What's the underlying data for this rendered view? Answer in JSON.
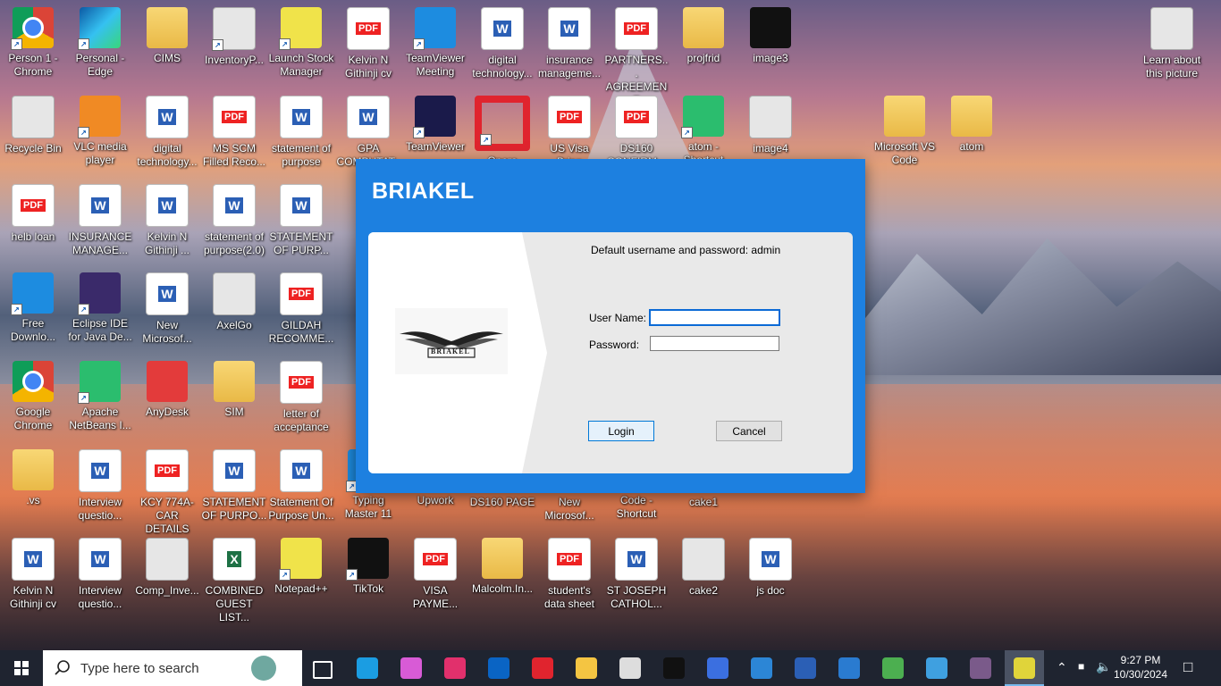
{
  "desktop": {
    "icons": [
      {
        "label": "Person 1 -\nChrome",
        "type": "chrome",
        "shortcut": true
      },
      {
        "label": "Personal -\nEdge",
        "type": "edge",
        "shortcut": true
      },
      {
        "label": "CIMS",
        "type": "folder"
      },
      {
        "label": "InventoryP...",
        "type": "gray",
        "shortcut": true
      },
      {
        "label": "Launch Stock\nManager",
        "type": "yellow",
        "shortcut": true
      },
      {
        "label": "Kelvin N\nGithinji cv",
        "type": "pdf"
      },
      {
        "label": "TeamViewer\nMeeting",
        "type": "blue",
        "shortcut": true
      },
      {
        "label": "digital\ntechnology...",
        "type": "word"
      },
      {
        "label": "insurance\nmanageme...",
        "type": "word"
      },
      {
        "label": "PARTNERS...\nAGREEMENT",
        "type": "pdf"
      },
      {
        "label": "projfrid",
        "type": "folder"
      },
      {
        "label": "image3",
        "type": "black"
      },
      {
        "label": "Recycle Bin",
        "type": "gray"
      },
      {
        "label": "VLC media\nplayer",
        "type": "orange",
        "shortcut": true
      },
      {
        "label": "digital\ntechnology...",
        "type": "word"
      },
      {
        "label": "MS SCM\nFilled Reco...",
        "type": "pdf"
      },
      {
        "label": "statement of\npurpose",
        "type": "word"
      },
      {
        "label": "GPA\nCOMPUTAT...",
        "type": "word"
      },
      {
        "label": "TeamViewer",
        "type": "dark",
        "shortcut": true
      },
      {
        "label": "Opera\nBrowser",
        "type": "opera",
        "shortcut": true
      },
      {
        "label": "US Visa Brian",
        "type": "pdf"
      },
      {
        "label": "DS160\nCONFIRM...",
        "type": "pdf"
      },
      {
        "label": "atom -\nShortcut",
        "type": "green",
        "shortcut": true
      },
      {
        "label": "image4",
        "type": "gray"
      },
      {
        "label": "Microsoft VS\nCode",
        "type": "folder"
      },
      {
        "label": "atom",
        "type": "folder"
      },
      {
        "label": "helb loan",
        "type": "pdf"
      },
      {
        "label": "INSURANCE\nMANAGE...",
        "type": "word"
      },
      {
        "label": "Kelvin N\nGithinji ...",
        "type": "word"
      },
      {
        "label": "statement of\npurpose(2.0)",
        "type": "word"
      },
      {
        "label": "STATEMENT\nOF PURP...",
        "type": "word"
      },
      {
        "label": "Free\nDownlo...",
        "type": "blue",
        "shortcut": true
      },
      {
        "label": "Eclipse IDE\nfor Java De...",
        "type": "purple",
        "shortcut": true
      },
      {
        "label": "New\nMicrosof...",
        "type": "word"
      },
      {
        "label": "AxelGo",
        "type": "gray"
      },
      {
        "label": "GILDAH\nRECOMME...",
        "type": "pdf"
      },
      {
        "label": "Google\nChrome",
        "type": "chrome"
      },
      {
        "label": "Apache\nNetBeans I...",
        "type": "green",
        "shortcut": true
      },
      {
        "label": "AnyDesk",
        "type": "red"
      },
      {
        "label": "SIM",
        "type": "folder"
      },
      {
        "label": "letter of\nacceptance",
        "type": "pdf"
      },
      {
        "label": ".vs",
        "type": "folder"
      },
      {
        "label": "Interview\nquestio...",
        "type": "word"
      },
      {
        "label": "KCY 774A-\nCAR DETAILS",
        "type": "pdf"
      },
      {
        "label": "STATEMENT\nOF PURPO...",
        "type": "word"
      },
      {
        "label": "Statement Of\nPurpose Un...",
        "type": "word"
      },
      {
        "label": "Typing\nMaster 11",
        "type": "blue",
        "shortcut": true
      },
      {
        "label": "Upwork",
        "type": "green"
      },
      {
        "label": "DS160 PAGE",
        "type": "pdf"
      },
      {
        "label": "New\nMicrosof...",
        "type": "word"
      },
      {
        "label": "Code -\nShortcut",
        "type": "blue",
        "shortcut": true
      },
      {
        "label": "cake1",
        "type": "gray"
      },
      {
        "label": "Kelvin N\nGithinji cv",
        "type": "word"
      },
      {
        "label": "Interview\nquestio...",
        "type": "word"
      },
      {
        "label": "Comp_Inve...",
        "type": "gray"
      },
      {
        "label": "COMBINED\nGUEST LIST...",
        "type": "excel"
      },
      {
        "label": "Notepad++",
        "type": "yellow",
        "shortcut": true
      },
      {
        "label": "TikTok",
        "type": "black",
        "shortcut": true
      },
      {
        "label": "VISA\nPAYME...",
        "type": "pdf"
      },
      {
        "label": "Malcolm.In...",
        "type": "folder"
      },
      {
        "label": "student's\ndata sheet",
        "type": "pdf"
      },
      {
        "label": "ST JOSEPH\nCATHOL...",
        "type": "word"
      },
      {
        "label": "cake2",
        "type": "gray"
      },
      {
        "label": "js doc",
        "type": "word"
      },
      {
        "label": "Learn about\nthis picture",
        "type": "gray"
      }
    ]
  },
  "dialog": {
    "title": "BRIAKEL",
    "logo_text": "BRIAKEL",
    "hint": "Default username and password: admin",
    "username_label": "User Name:",
    "password_label": "Password:",
    "username_value": "",
    "password_value": "",
    "login_label": "Login",
    "cancel_label": "Cancel"
  },
  "taskbar": {
    "search_placeholder": "Type here to search",
    "time": "9:27 PM",
    "date": "10/30/2024",
    "apps": [
      "task-view",
      "edge",
      "copilot",
      "instagram",
      "outlook",
      "opera",
      "file-explorer",
      "other",
      "tiktok",
      "copilot-2",
      "store",
      "word",
      "notes",
      "chrome",
      "photos",
      "app",
      "stock-manager"
    ]
  }
}
